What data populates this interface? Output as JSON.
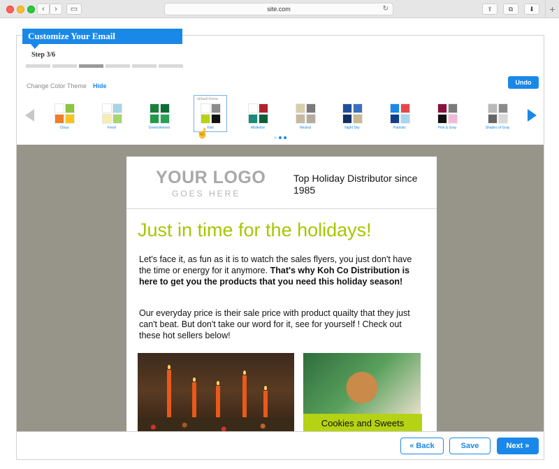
{
  "browser": {
    "url": "site.com",
    "back_glyph": "‹",
    "forward_glyph": "›",
    "sidebar_glyph": "▭",
    "reload_glyph": "↻",
    "share_glyph": "⇪",
    "tabs_glyph": "⧉",
    "download_glyph": "⬇",
    "new_tab_glyph": "+"
  },
  "wizard": {
    "title": "Customize Your Email",
    "step": "Step 3/6",
    "total_steps": 6,
    "current_step": 3
  },
  "theme_picker": {
    "label": "Change Color Theme",
    "hide_label": "Hide",
    "undo_label": "Undo",
    "default_tag": "default theme",
    "selected_theme": "Kiwi",
    "themes": [
      {
        "name": "Citrus",
        "colors": [
          "#ffffff",
          "#8cc63f",
          "#f07e26",
          "#f7c31c"
        ]
      },
      {
        "name": "Fresh",
        "colors": [
          "#ffffff",
          "#a8d4e6",
          "#f5eeb0",
          "#a6d66e"
        ]
      },
      {
        "name": "Greensleeves",
        "colors": [
          "#1a7f3c",
          "#0e6b34",
          "#1f9a4a",
          "#2aa055"
        ]
      },
      {
        "name": "Kiwi",
        "colors": [
          "#ffffff",
          "#8c8c8c",
          "#b5d312",
          "#111111"
        ]
      },
      {
        "name": "Mistletoe",
        "colors": [
          "#ffffff",
          "#b0222c",
          "#1b8a7a",
          "#0e5f3a"
        ]
      },
      {
        "name": "Neutral",
        "colors": [
          "#d8cfa8",
          "#7a7a7a",
          "#c9b8a0",
          "#b5aaa0"
        ]
      },
      {
        "name": "Night Sky",
        "colors": [
          "#1f4f99",
          "#3a6fc0",
          "#0f2f66",
          "#c9b890"
        ]
      },
      {
        "name": "Patriotic",
        "colors": [
          "#1a88e8",
          "#e8464a",
          "#0f3f8a",
          "#a8d4f0"
        ]
      },
      {
        "name": "Pink & Gray",
        "colors": [
          "#8a0f3f",
          "#7a7a7a",
          "#111111",
          "#f3b8d8"
        ]
      },
      {
        "name": "Shades of Gray",
        "colors": [
          "#b8b8b8",
          "#8a8a8a",
          "#666666",
          "#d8d8d8"
        ]
      }
    ],
    "page_dots": 3,
    "active_dot": 1
  },
  "email": {
    "logo_main": "YOUR LOGO",
    "logo_sub": "GOES HERE",
    "tagline": "Top Holiday Distributor since 1985",
    "headline": "Just in time for the holidays!",
    "para1_normal": "Let's face it, as fun as it is to watch the sales flyers, you just don't have the time or energy for it anymore. ",
    "para1_bold": "That's why Koh Co Distribution is here to get you the products that you need this holiday season!",
    "para2": "Our everyday price is their sale price with product quailty that they just can't beat. But don't take our word for it, see for yourself ! Check out these hot sellers below!",
    "product_caption": "Cookies and Sweets",
    "accent_color": "#a6c700"
  },
  "footer": {
    "back_label": "« Back",
    "save_label": "Save",
    "next_label": "Next »"
  }
}
